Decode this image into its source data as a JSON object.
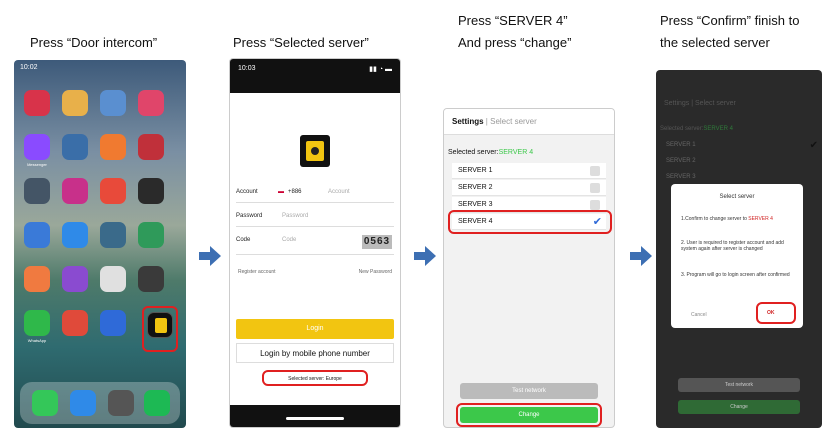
{
  "captions": {
    "step1": "Press “Door intercom”",
    "step2": "Press “Selected server”",
    "step3_line1": "Press “SERVER 4”",
    "step3_line2": "And press “change”",
    "step4_line1": "Press “Confirm” finish to",
    "step4_line2": "the selected server"
  },
  "phone1": {
    "time": "10:02",
    "apps": [
      {
        "label": "",
        "color": "#d8334a"
      },
      {
        "label": "",
        "color": "#e8b04a"
      },
      {
        "label": "",
        "color": "#5a8fd0"
      },
      {
        "label": "",
        "color": "#e0456a"
      },
      {
        "label": "Messenger",
        "color": "#8a4bff"
      },
      {
        "label": "",
        "color": "#3a6ea8"
      },
      {
        "label": "",
        "color": "#f07a30"
      },
      {
        "label": "",
        "color": "#c0303a"
      },
      {
        "label": "",
        "color": "#445566"
      },
      {
        "label": "",
        "color": "#c8308a"
      },
      {
        "label": "",
        "color": "#e84a3a"
      },
      {
        "label": "",
        "color": "#2a2a2a"
      },
      {
        "label": "",
        "color": "#3a7ad8"
      },
      {
        "label": "",
        "color": "#2f8ae8"
      },
      {
        "label": "",
        "color": "#3a6a8a"
      },
      {
        "label": "",
        "color": "#2f9a5a"
      },
      {
        "label": "",
        "color": "#f07a40"
      },
      {
        "label": "",
        "color": "#8a4bd0"
      },
      {
        "label": "",
        "color": "#e0e0e0"
      },
      {
        "label": "",
        "color": "#3a3a3a"
      },
      {
        "label": "WhatsApp",
        "color": "#2fb84a"
      },
      {
        "label": "",
        "color": "#e04a3a"
      },
      {
        "label": "",
        "color": "#2f6ad8"
      },
      {
        "label": "",
        "color": "#1a1a1a"
      }
    ],
    "dock": [
      "#34c759",
      "#2f8ae8",
      "#555555",
      "#1db954"
    ]
  },
  "phone2": {
    "time": "10:03",
    "account_label": "Account",
    "country_code": "+886",
    "account_placeholder": "Account",
    "password_label": "Password",
    "password_placeholder": "Password",
    "code_label": "Code",
    "code_placeholder": "Code",
    "captcha": "0563",
    "register": "Register account",
    "forgot": "New Password",
    "login": "Login",
    "login_mobile": "Login by mobile phone number",
    "selected_server": "Selected server: Europe"
  },
  "phone3": {
    "title": "Settings",
    "subtitle": "Select server",
    "selected_label": "Selected server:",
    "selected_value": "SERVER 4",
    "servers": [
      "SERVER 1",
      "SERVER 2",
      "SERVER 3",
      "SERVER 4"
    ],
    "test_network": "Test network",
    "change": "Change"
  },
  "phone4": {
    "title": "Settings",
    "subtitle": "Select server",
    "selected_label": "Selected server:",
    "selected_value": "SERVER 4",
    "servers": [
      "SERVER 1",
      "SERVER 2",
      "SERVER 3"
    ],
    "dialog_title": "Select server",
    "msg1": "1.Confirm to change server to",
    "msg1_value": "SERVER 4",
    "msg2": "2. User is required to register account and add system again after server is changed",
    "msg3": "3. Program will go to login screen after confirmed",
    "cancel": "Cancel",
    "ok": "OK",
    "test_network": "Test network",
    "change": "Change"
  },
  "colors": {
    "accent_green": "#3cc84a",
    "login_yellow": "#f2c511",
    "highlight_red": "#e02020",
    "arrow_blue": "#3d6fb3"
  }
}
